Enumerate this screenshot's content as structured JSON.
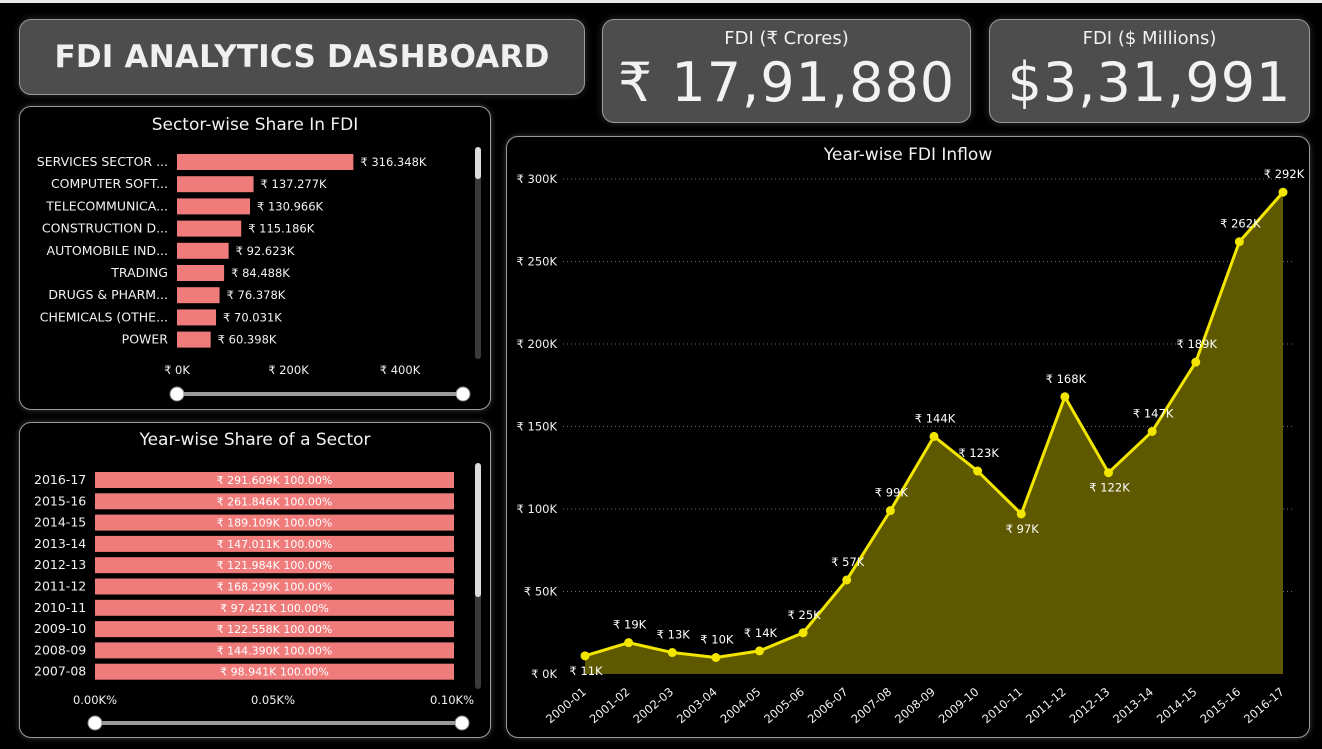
{
  "header": {
    "title": "FDI ANALYTICS DASHBOARD"
  },
  "kpi": [
    {
      "label": "FDI (₹ Crores)",
      "value": "₹ 17,91,880"
    },
    {
      "label": "FDI ($ Millions)",
      "value": "$3,31,991"
    }
  ],
  "chart_data": [
    {
      "type": "bar",
      "orientation": "horizontal",
      "title": "Sector-wise Share In FDI",
      "categories": [
        "SERVICES SECTOR ...",
        "COMPUTER SOFT...",
        "TELECOMMUNICA...",
        "CONSTRUCTION D...",
        "AUTOMOBILE IND...",
        "TRADING",
        "DRUGS & PHARM...",
        "CHEMICALS (OTHE...",
        "POWER"
      ],
      "values": [
        316.348,
        137.277,
        130.966,
        115.186,
        92.623,
        84.488,
        76.378,
        70.031,
        60.398
      ],
      "data_labels": [
        "₹ 316.348K",
        "₹ 137.277K",
        "₹ 130.966K",
        "₹ 115.186K",
        "₹ 92.623K",
        "₹ 84.488K",
        "₹ 76.378K",
        "₹ 70.031K",
        "₹ 60.398K"
      ],
      "value_unit": "K",
      "xlim": [
        0,
        400
      ],
      "x_ticks": [
        "₹ 0K",
        "₹ 200K",
        "₹ 400K"
      ],
      "bar_color": "#f07b7b"
    },
    {
      "type": "bar",
      "orientation": "horizontal",
      "stacked_percent": true,
      "title": "Year-wise Share of a Sector",
      "categories": [
        "2016-17",
        "2015-16",
        "2014-15",
        "2013-14",
        "2012-13",
        "2011-12",
        "2010-11",
        "2009-10",
        "2008-09",
        "2007-08"
      ],
      "values": [
        100,
        100,
        100,
        100,
        100,
        100,
        100,
        100,
        100,
        100
      ],
      "data_labels": [
        "₹ 291.609K 100.00%",
        "₹ 261.846K 100.00%",
        "₹ 189.109K 100.00%",
        "₹ 147.011K 100.00%",
        "₹ 121.984K 100.00%",
        "₹ 168.299K 100.00%",
        "₹ 97.421K 100.00%",
        "₹ 122.558K 100.00%",
        "₹ 144.390K 100.00%",
        "₹ 98.941K 100.00%"
      ],
      "x_ticks": [
        "0.00K%",
        "0.05K%",
        "0.10K%"
      ],
      "bar_color": "#f07b7b"
    },
    {
      "type": "area",
      "title": "Year-wise FDI Inflow",
      "categories": [
        "2000-01",
        "2001-02",
        "2002-03",
        "2003-04",
        "2004-05",
        "2005-06",
        "2006-07",
        "2007-08",
        "2008-09",
        "2009-10",
        "2010-11",
        "2011-12",
        "2012-13",
        "2013-14",
        "2014-15",
        "2015-16",
        "2016-17"
      ],
      "values": [
        11,
        19,
        13,
        10,
        14,
        25,
        57,
        99,
        144,
        123,
        97,
        168,
        122,
        147,
        189,
        262,
        292
      ],
      "data_labels": [
        "₹ 11K",
        "₹ 19K",
        "₹ 13K",
        "₹ 10K",
        "₹ 14K",
        "₹ 25K",
        "₹ 57K",
        "₹ 99K",
        "₹ 144K",
        "₹ 123K",
        "₹ 97K",
        "₹ 168K",
        "₹ 122K",
        "₹ 147K",
        "₹ 189K",
        "₹ 262K",
        "₹ 292K"
      ],
      "value_unit": "K",
      "ylim": [
        0,
        300
      ],
      "y_ticks": [
        "₹ 0K",
        "₹ 50K",
        "₹ 100K",
        "₹ 150K",
        "₹ 200K",
        "₹ 250K",
        "₹ 300K"
      ],
      "line_color": "#f2e600",
      "fill_color": "#5e5800",
      "grid": true
    }
  ]
}
